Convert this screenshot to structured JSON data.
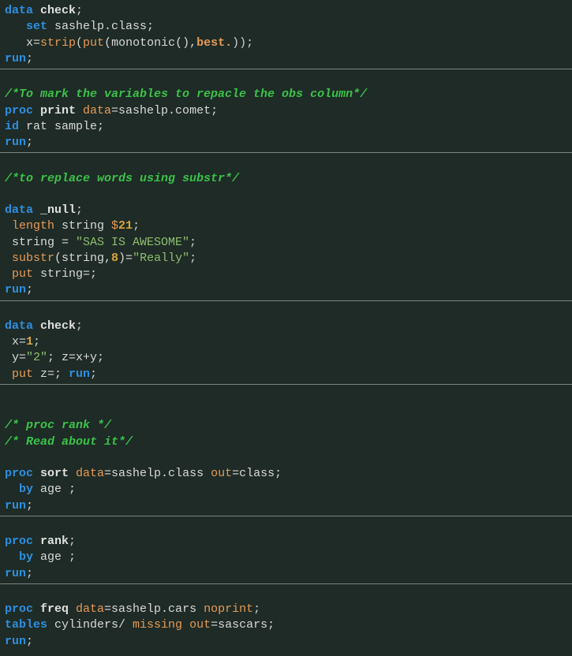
{
  "code": {
    "block1": {
      "l1_data": "data",
      "l1_check": " check",
      "l1_semi": ";",
      "l2_set": "   set",
      "l2_rest": " sashelp.class;",
      "l3a": "   x=",
      "l3_strip": "strip",
      "l3b": "(",
      "l3_put": "put",
      "l3c": "(monotonic(),",
      "l3_best": "best.",
      "l3d": "));",
      "l4_run": "run",
      "l4_semi": ";"
    },
    "block2": {
      "c1": "/*To mark the variables to repacle the obs column*/",
      "l1_proc": "proc",
      "l1_print": " print",
      "l1_dataopt": " data",
      "l1_rest": "=sashelp.comet;",
      "l2_id": "id",
      "l2_rest": " rat sample;",
      "l3_run": "run",
      "l3_semi": ";"
    },
    "block3": {
      "c1": "/*to replace words using substr*/",
      "l1_data": "data",
      "l1_name": " _null",
      "l1_semi": ";",
      "l2_len": " length",
      "l2_mid": " string ",
      "l2_dollar": "$",
      "l2_num": "21",
      "l2_semi": ";",
      "l3a": " string = ",
      "l3_str": "\"SAS IS AWESOME\"",
      "l3b": ";",
      "l4_sub": " substr",
      "l4a": "(string,",
      "l4_num": "8",
      "l4b": ")=",
      "l4_str": "\"Really\"",
      "l4c": ";",
      "l5_put": " put",
      "l5_rest": " string=;",
      "l6_run": "run",
      "l6_semi": ";"
    },
    "block4": {
      "l1_data": "data",
      "l1_name": " check",
      "l1_semi": ";",
      "l2a": " x=",
      "l2_num": "1",
      "l2b": ";",
      "l3a": " y=",
      "l3_str": "\"2\"",
      "l3b": "; z=x+y;",
      "l4_put": " put",
      "l4a": " z=; ",
      "l4_run": "run",
      "l4b": ";"
    },
    "block5": {
      "c1": "/* proc rank */",
      "c2": "/* Read about it*/",
      "l1_proc": "proc",
      "l1_sort": " sort",
      "l1_data": " data",
      "l1_mid": "=sashelp.class ",
      "l1_out": "out",
      "l1_rest": "=class;",
      "l2_by": "  by",
      "l2_rest": " age ;",
      "l3_run": "run",
      "l3_semi": ";"
    },
    "block6": {
      "l1_proc": "proc",
      "l1_rank": " rank",
      "l1_semi": ";",
      "l2_by": "  by",
      "l2_rest": " age ;",
      "l3_run": "run",
      "l3_semi": ";"
    },
    "block7": {
      "l1_proc": "proc",
      "l1_freq": " freq",
      "l1_data": " data",
      "l1_mid": "=sashelp.cars ",
      "l1_nop": "noprint",
      "l1_semi": ";",
      "l2_tab": "tables",
      "l2_mid": " cylinders/ ",
      "l2_miss": "missing",
      "l2_sp": " ",
      "l2_out": "out",
      "l2_rest": "=sascars;",
      "l3_run": "run",
      "l3_semi": ";"
    }
  }
}
